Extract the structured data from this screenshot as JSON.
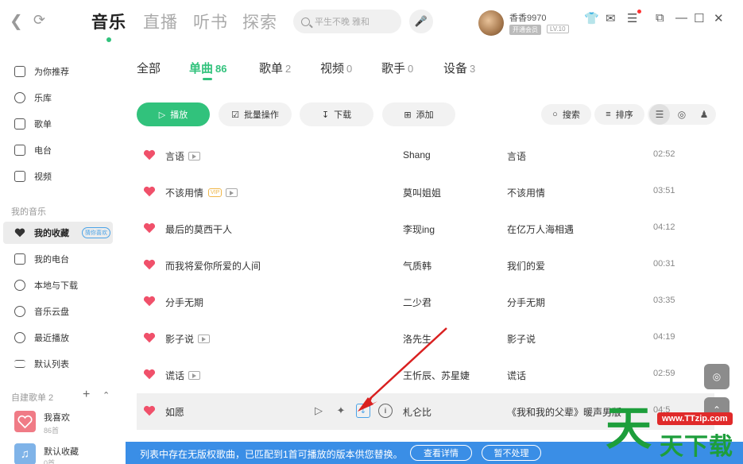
{
  "topbar": {
    "tabs": [
      "音乐",
      "直播",
      "听书",
      "探索"
    ],
    "search_placeholder": "平生不晚 雅和",
    "username": "香香9970",
    "badge_open": "开通会员",
    "badge_level": "LV.10"
  },
  "sidebar": {
    "items": [
      "为你推荐",
      "乐库",
      "歌单",
      "电台",
      "视频"
    ],
    "section_my_music": "我的音乐",
    "my_items": [
      "我的收藏",
      "我的电台",
      "本地与下载",
      "音乐云盘",
      "最近播放",
      "默认列表"
    ],
    "favorite_chip": "猜你喜欢",
    "section_created": "自建歌单 2",
    "playlists": [
      {
        "name": "我喜欢",
        "count": "86首"
      },
      {
        "name": "默认收藏",
        "count": "0首"
      }
    ]
  },
  "subtabs": [
    {
      "label": "全部",
      "count": ""
    },
    {
      "label": "单曲",
      "count": "86"
    },
    {
      "label": "歌单",
      "count": "2"
    },
    {
      "label": "视频",
      "count": "0"
    },
    {
      "label": "歌手",
      "count": "0"
    },
    {
      "label": "设备",
      "count": "3"
    }
  ],
  "toolbar": {
    "play": "播放",
    "batch": "批量操作",
    "download": "下载",
    "add": "添加",
    "search": "搜索",
    "sort": "排序"
  },
  "songs": [
    {
      "title": "言语",
      "artist": "Shang",
      "album": "言语",
      "duration": "02:52"
    },
    {
      "title": "不该用情",
      "artist": "莫叫姐姐",
      "album": "不该用情",
      "duration": "03:51"
    },
    {
      "title": "最后的莫西干人",
      "artist": "李现ing",
      "album": "在亿万人海相遇",
      "duration": "04:12"
    },
    {
      "title": "而我将爱你所爱的人间",
      "artist": "气质韩",
      "album": "我们的爱",
      "duration": "00:31"
    },
    {
      "title": "分手无期",
      "artist": "二少君",
      "album": "分手无期",
      "duration": "03:35"
    },
    {
      "title": "影子说",
      "artist": "洛先生",
      "album": "影子说",
      "duration": "04:19"
    },
    {
      "title": "谎话",
      "artist": "王忻辰、苏星婕",
      "album": "谎话",
      "duration": "02:59"
    },
    {
      "title": "如愿",
      "artist": "札仑比",
      "album": "《我和我的父辈》暖声男版",
      "duration": "04:5"
    }
  ],
  "banner": {
    "text": "列表中存在无版权歌曲，已匹配到1首可播放的版本供您替换。",
    "details": "查看详情",
    "ignore": "暂不处理"
  },
  "watermark": {
    "url": "www.TTzip.com",
    "big": "天",
    "small": "天下载"
  },
  "colors": {
    "accent": "#31c27c",
    "heart": "#f0506a",
    "banner": "#3a8ee6"
  }
}
